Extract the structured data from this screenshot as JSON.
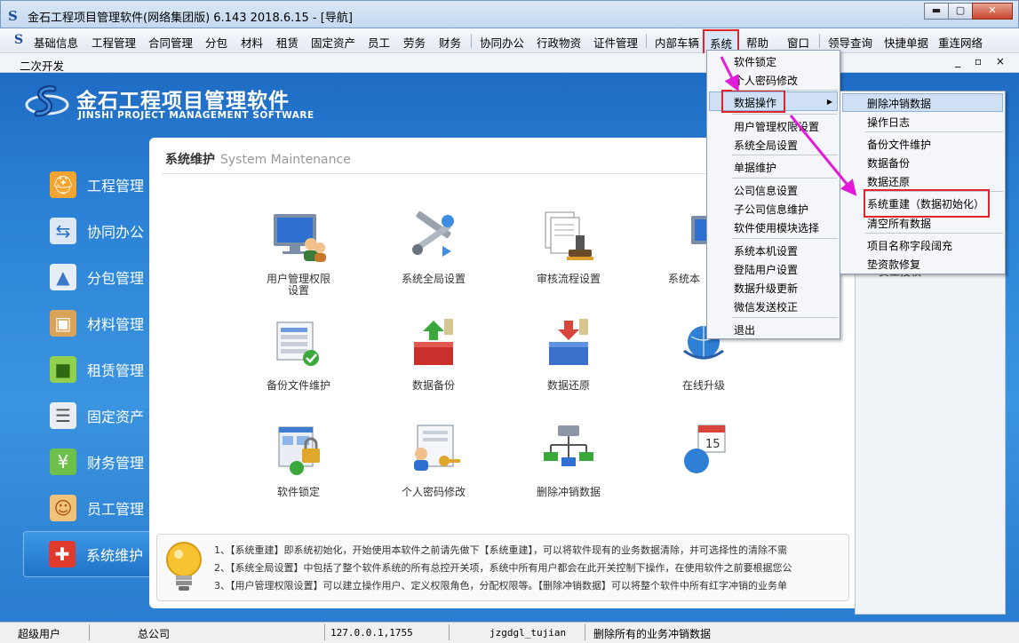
{
  "window": {
    "title": "金石工程项目管理软件(网络集团版) 6.143  2018.6.15 - [导航]",
    "app_icon": "S",
    "min_label": "▬",
    "max_label": "▢",
    "close_label": "✕"
  },
  "menubar": {
    "logo": "S",
    "items": [
      "基础信息",
      "工程管理",
      "合同管理",
      "分包",
      "材料",
      "租赁",
      "固定资产",
      "员工",
      "劳务",
      "财务",
      "协同办公",
      "行政物资",
      "证件管理",
      "内部车辆",
      "系统",
      "帮助",
      "窗口",
      "领导查询",
      "快捷单据",
      "重连网络"
    ],
    "active": "系统"
  },
  "subbar": {
    "label": "二次开发",
    "mdi_controls": "_ ▫ ×"
  },
  "brand": {
    "name_cn": "金石工程项目管理软件",
    "name_en": "JINSHI PROJECT MANAGEMENT SOFTWARE"
  },
  "nav": {
    "items": [
      {
        "label": "工程管理",
        "icon": "worker-icon"
      },
      {
        "label": "协同办公",
        "icon": "network-icon"
      },
      {
        "label": "分包管理",
        "icon": "road-icon"
      },
      {
        "label": "材料管理",
        "icon": "box-icon"
      },
      {
        "label": "租赁管理",
        "icon": "cubes-icon"
      },
      {
        "label": "固定资产",
        "icon": "server-icon"
      },
      {
        "label": "财务管理",
        "icon": "money-icon"
      },
      {
        "label": "员工管理",
        "icon": "people-icon"
      },
      {
        "label": "系统维护",
        "icon": "toolbox-icon"
      }
    ],
    "active": "系统维护"
  },
  "panel": {
    "title_cn": "系统维护",
    "title_en": "System Maintenance",
    "tiles": [
      {
        "label": "用户管理权限设置"
      },
      {
        "label": "系统全局设置"
      },
      {
        "label": "审核流程设置"
      },
      {
        "label": "系统本"
      },
      {
        "label": "备份文件维护"
      },
      {
        "label": "数据备份"
      },
      {
        "label": "数据还原"
      },
      {
        "label": "在线升级"
      },
      {
        "label": "软件锁定"
      },
      {
        "label": "个人密码修改"
      },
      {
        "label": "删除冲销数据"
      },
      {
        "label": ""
      }
    ],
    "tips": [
      "1、【系统重建】即系统初始化，开始使用本软件之前请先做下【系统重建】，可以将软件现有的业务数据清除，并可选择性的清除不需",
      "2、【系统全局设置】中包括了整个软件系统的所有总控开关项，系统中所有用户都会在此开关控制下操作，在使用软件之前要根据您公",
      "3、【用户管理权限设置】可以建立操作用户、定义权限角色，分配权限等。【删除冲销数据】可以将整个软件中所有红字冲销的业务单"
    ]
  },
  "side_panel": {
    "partial_text": "员工授权"
  },
  "system_menu": {
    "items": [
      "软件锁定",
      "个人密码修改",
      "数据操作",
      "用户管理权限设置",
      "系统全局设置",
      "单据维护",
      "公司信息设置",
      "子公司信息维护",
      "软件使用模块选择",
      "系统本机设置",
      "登陆用户设置",
      "数据升级更新",
      "微信发送校正",
      "退出"
    ],
    "submenu_arrow": "▶",
    "highlighted": "数据操作"
  },
  "data_submenu": {
    "items": [
      "删除冲销数据",
      "操作日志",
      "备份文件维护",
      "数据备份",
      "数据还原",
      "系统重建（数据初始化）",
      "清空所有数据",
      "项目名称字段阔充",
      "垫资款修复"
    ],
    "highlighted": "删除冲销数据",
    "boxed": "系统重建（数据初始化）"
  },
  "statusbar": {
    "user": "超级用户",
    "company": "总公司",
    "server": "127.0.0.1,1755",
    "database": "jzgdgl_tujian",
    "message": "删除所有的业务冲销数据"
  },
  "colors": {
    "accent_blue": "#2b82d6",
    "highlight_red": "#e0242a",
    "arrow_magenta": "#e21bd8"
  }
}
